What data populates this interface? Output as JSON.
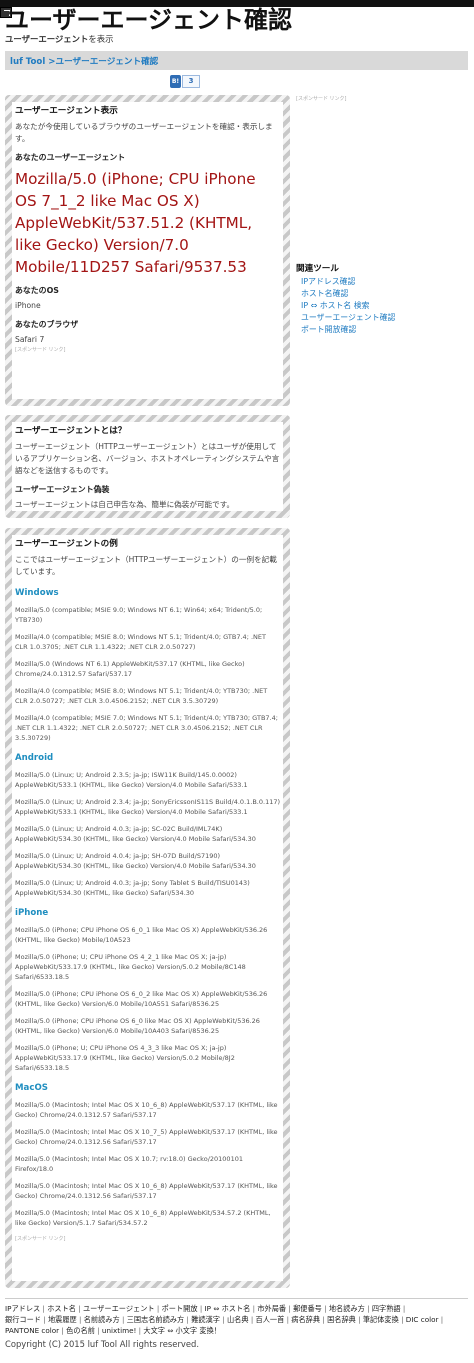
{
  "header": {
    "title": "ユーザーエージェント確認",
    "subtitle_bold": "ユーザーエージェント",
    "subtitle_rest": "を表示"
  },
  "breadcrumb": {
    "home": "luf Tool",
    "sep": " >",
    "current": "ユーザーエージェント確認"
  },
  "share": {
    "logo": "B!",
    "count": "3"
  },
  "sponsor_label": "[スポンサード リンク]",
  "panel1": {
    "heading": "ユーザーエージェント表示",
    "intro": "あなたが今使用しているブラウザのユーザーエージェントを確認・表示します。",
    "ua_heading": "あなたのユーザーエージェント",
    "ua_value": "Mozilla/5.0 (iPhone; CPU iPhone OS 7_1_2 like Mac OS X) AppleWebKit/537.51.2 (KHTML, like Gecko) Version/7.0 Mobile/11D257 Safari/9537.53",
    "os_heading": "あなたのOS",
    "os_value": "iPhone",
    "browser_heading": "あなたのブラウザ",
    "browser_value": "Safari 7"
  },
  "panel2": {
    "heading": "ユーザーエージェントとは？",
    "body": "ユーザーエージェント（HTTPユーザーエージェント）とはユーザが使用しているアプリケーション名、バージョン、ホストオペレーティングシステムや言語などを送信するものです。",
    "fake_heading": "ユーザーエージェント偽装",
    "fake_body": "ユーザーエージェントは自己申告な為、簡単に偽装が可能です。"
  },
  "panel3": {
    "heading": "ユーザーエージェントの例",
    "intro": "ここではユーザーエージェント（HTTPユーザーエージェント）の一例を記載しています。",
    "groups": [
      {
        "name": "Windows",
        "items": [
          "Mozilla/5.0 (compatible; MSIE 9.0; Windows NT 6.1; Win64; x64; Trident/5.0; YTB730)",
          "Mozilla/4.0 (compatible; MSIE 8.0; Windows NT 5.1; Trident/4.0; GTB7.4; .NET CLR 1.0.3705; .NET CLR 1.1.4322; .NET CLR 2.0.50727)",
          "Mozilla/5.0 (Windows NT 6.1) AppleWebKit/537.17 (KHTML, like Gecko) Chrome/24.0.1312.57 Safari/537.17",
          "Mozilla/4.0 (compatible; MSIE 8.0; Windows NT 5.1; Trident/4.0; YTB730; .NET CLR 2.0.50727; .NET CLR 3.0.4506.2152; .NET CLR 3.5.30729)",
          "Mozilla/4.0 (compatible; MSIE 7.0; Windows NT 5.1; Trident/4.0; YTB730; GTB7.4; .NET CLR 1.1.4322; .NET CLR 2.0.50727; .NET CLR 3.0.4506.2152; .NET CLR 3.5.30729)"
        ]
      },
      {
        "name": "Android",
        "items": [
          "Mozilla/5.0 (Linux; U; Android 2.3.5; ja-jp; ISW11K Build/145.0.0002) AppleWebKit/533.1 (KHTML, like Gecko) Version/4.0 Mobile Safari/533.1",
          "Mozilla/5.0 (Linux; U; Android 2.3.4; ja-jp; SonyEricssonIS11S Build/4.0.1.B.0.117) AppleWebKit/533.1 (KHTML, like Gecko) Version/4.0 Mobile Safari/533.1",
          "Mozilla/5.0 (Linux; U; Android 4.0.3; ja-jp; SC-02C Build/IML74K) AppleWebKit/534.30 (KHTML, like Gecko) Version/4.0 Mobile Safari/534.30",
          "Mozilla/5.0 (Linux; U; Android 4.0.4; ja-jp; SH-07D Build/S7190) AppleWebKit/534.30 (KHTML, like Gecko) Version/4.0 Mobile Safari/534.30",
          "Mozilla/5.0 (Linux; U; Android 4.0.3; ja-jp; Sony Tablet S Build/TISU0143) AppleWebKit/534.30 (KHTML, like Gecko) Safari/534.30"
        ]
      },
      {
        "name": "iPhone",
        "items": [
          "Mozilla/5.0 (iPhone; CPU iPhone OS 6_0_1 like Mac OS X) AppleWebKit/536.26 (KHTML, like Gecko) Mobile/10A523",
          "Mozilla/5.0 (iPhone; U; CPU iPhone OS 4_2_1 like Mac OS X; ja-jp) AppleWebKit/533.17.9 (KHTML, like Gecko) Version/5.0.2 Mobile/8C148 Safari/6533.18.5",
          "Mozilla/5.0 (iPhone; CPU iPhone OS 6_0_2 like Mac OS X) AppleWebKit/536.26 (KHTML, like Gecko) Version/6.0 Mobile/10A551 Safari/8536.25",
          "Mozilla/5.0 (iPhone; CPU iPhone OS 6_0 like Mac OS X) AppleWebKit/536.26 (KHTML, like Gecko) Version/6.0 Mobile/10A403 Safari/8536.25",
          "Mozilla/5.0 (iPhone; U; CPU iPhone OS 4_3_3 like Mac OS X; ja-jp) AppleWebKit/533.17.9 (KHTML, like Gecko) Version/5.0.2 Mobile/8J2 Safari/6533.18.5"
        ]
      },
      {
        "name": "MacOS",
        "items": [
          "Mozilla/5.0 (Macintosh; Intel Mac OS X 10_6_8) AppleWebKit/537.17 (KHTML, like Gecko) Chrome/24.0.1312.57 Safari/537.17",
          "Mozilla/5.0 (Macintosh; Intel Mac OS X 10_7_5) AppleWebKit/537.17 (KHTML, like Gecko) Chrome/24.0.1312.56 Safari/537.17",
          "Mozilla/5.0 (Macintosh; Intel Mac OS X 10.7; rv:18.0) Gecko/20100101 Firefox/18.0",
          "Mozilla/5.0 (Macintosh; Intel Mac OS X 10_6_8) AppleWebKit/537.17 (KHTML, like Gecko) Chrome/24.0.1312.56 Safari/537.17",
          "Mozilla/5.0 (Macintosh; Intel Mac OS X 10_6_8) AppleWebKit/534.57.2 (KHTML, like Gecko) Version/5.1.7 Safari/534.57.2"
        ]
      }
    ]
  },
  "sidebar": {
    "heading": "関連ツール",
    "links": [
      "IPアドレス確認",
      "ホスト名確認",
      "IP ⇔ ホスト名 検索",
      "ユーザーエージェント確認",
      "ポート開放確認"
    ]
  },
  "footer": {
    "links": [
      "IPアドレス",
      "ホスト名",
      "ユーザーエージェント",
      "ポート開放",
      "IP ⇔ ホスト名",
      "市外局番",
      "郵便番号",
      "地名読み方",
      "四字熟語",
      "銀行コード",
      "地震履歴",
      "名前読み方",
      "三国志名前読み方",
      "難読漢字",
      "山名典",
      "百人一首",
      "病名辞典",
      "国名辞典",
      "筆記体変換",
      "DIC color",
      "PANTONE color",
      "色の名前",
      "unixtime!",
      "大文字 ⇔ 小文字 変換！"
    ],
    "copyright": "Copyright (C) 2015 luf Tool All rights reserved."
  }
}
